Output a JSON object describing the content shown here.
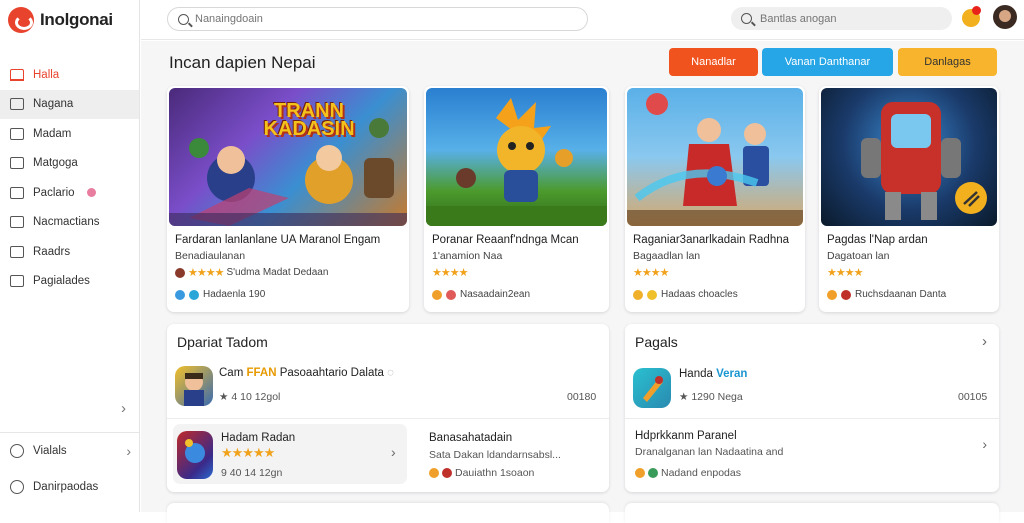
{
  "app": {
    "name": "Inolgonai"
  },
  "sidebar": {
    "items": [
      {
        "label": "Halla",
        "active": true
      },
      {
        "label": "Nagana"
      },
      {
        "label": "Madam"
      },
      {
        "label": "Matgoga"
      },
      {
        "label": "Paclario",
        "badge": true
      },
      {
        "label": "Nacmactians"
      },
      {
        "label": "Raadrs"
      },
      {
        "label": "Pagialades"
      }
    ],
    "bottom": [
      {
        "label": "Vialals"
      },
      {
        "label": "Danirpaodas"
      }
    ]
  },
  "topbar": {
    "search_placeholder": "Nanaingdoain",
    "search2_placeholder": "Bantlas anogan"
  },
  "page": {
    "title": "Incan dapien Nepai"
  },
  "buttons": {
    "b1": "Nanadlar",
    "b2": "Vanan Danthanar",
    "b3": "Danlagas"
  },
  "colors": {
    "accent": "#e8432c",
    "btn_orange": "#f0531e",
    "btn_blue": "#26a6e6",
    "btn_yellow": "#f7b42c",
    "star": "#f1a21b"
  },
  "cards": [
    {
      "title": "Fardaran lanlanlane UA Maranol Engam",
      "sub": "Benadiaulanan",
      "rating_text": "S'udma Madat   Dedaan",
      "foot": "Hadaenla 190",
      "banner": "TRANN KADASIN"
    },
    {
      "title": "Poranar Reaanf'ndnga Mcan",
      "sub": "1'anamion Naa",
      "rating_text": "",
      "foot": "Nasaadain2ean",
      "banner": ""
    },
    {
      "title": "Raganiar3anarlkadain Radhna",
      "sub": "Bagaadlan lan",
      "rating_text": "",
      "foot": "Hadaas choacles",
      "banner": ""
    },
    {
      "title": "Pagdas l'Nap ardan",
      "sub": "Dagatoan lan",
      "rating_text": "",
      "foot": "Ruchsdaanan Danta",
      "banner": ""
    }
  ],
  "panels": {
    "left": {
      "title": "Dpariat Tadom",
      "row1": {
        "title_pre": "Cam",
        "title_hl": "FFAN",
        "title_post": "Pasoaahtario Dalata",
        "meta": "4 10 12gol",
        "num": "00180"
      },
      "row2": {
        "title": "Hadam Radan",
        "meta": "9 40 14 12gn"
      },
      "row3": {
        "title": "Banasahatadain",
        "sub": "Sata Dakan ldandarnsabsl...",
        "foot": "Dauiathn 1soaon"
      }
    },
    "right": {
      "title": "Pagals",
      "row1": {
        "title_pre": "Handa",
        "title_hl": "Veran",
        "meta": "1290 Nega",
        "num": "00105"
      },
      "row2": {
        "title": "Hdprkkanm Paranel",
        "sub": "Dranalganan lan Nadaatina and",
        "foot": "Nadand enpodas"
      }
    }
  }
}
